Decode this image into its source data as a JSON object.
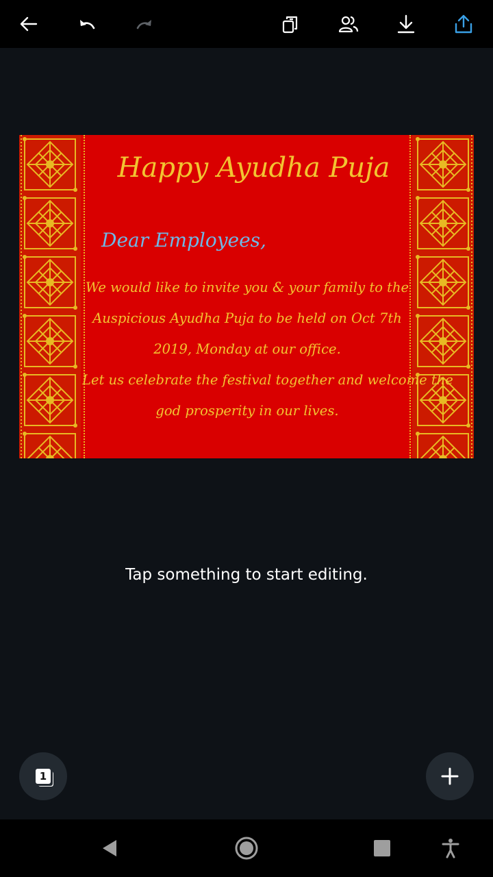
{
  "toolbar": {
    "icons": [
      "back-arrow-icon",
      "undo-icon",
      "redo-icon",
      "copy-page-icon",
      "collaborate-icon",
      "download-icon",
      "share-icon"
    ]
  },
  "card": {
    "title": "Happy Ayudha Puja",
    "greeting": "Dear Employees,",
    "body_lines": [
      "We would like to invite you & your family to the",
      "Auspicious Ayudha Puja to be held on Oct 7th",
      "2019, Monday at our office.",
      "Let us celebrate the festival together and welcome the",
      "god prosperity in our lives."
    ],
    "colors": {
      "background": "#d90000",
      "text": "#f2c431",
      "greeting": "#6fb8e6"
    }
  },
  "hint": "Tap something to start editing.",
  "pages_button": {
    "page_number": "1"
  },
  "add_button": {
    "icon": "plus-icon"
  },
  "navbar": {
    "icons": [
      "nav-back-icon",
      "nav-home-icon",
      "nav-recents-icon",
      "accessibility-icon"
    ]
  }
}
